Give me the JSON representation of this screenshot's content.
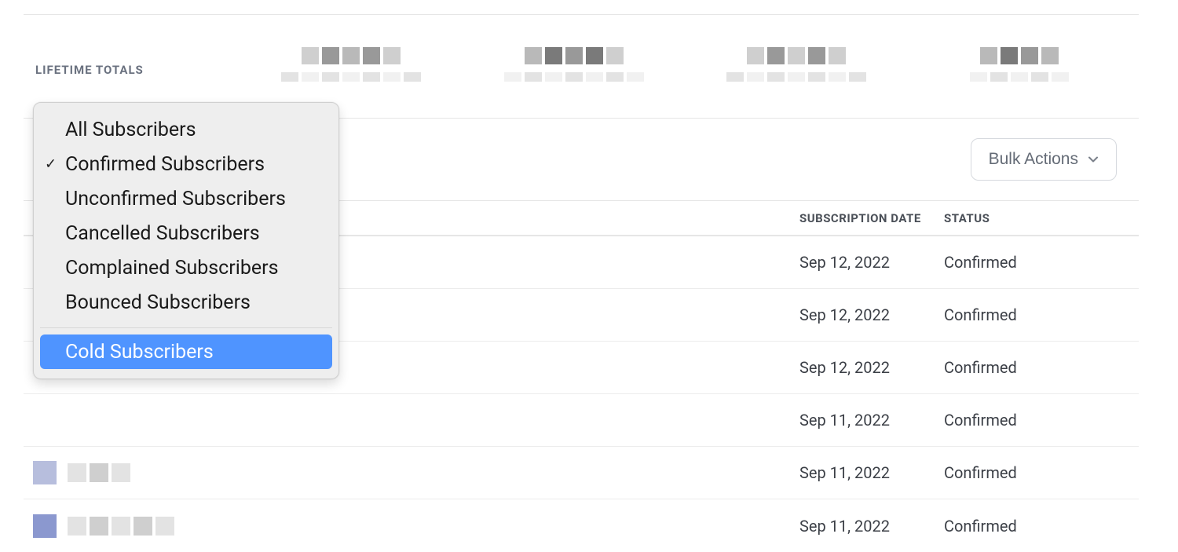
{
  "header": {
    "lifetime_totals_label": "LIFETIME TOTALS"
  },
  "toolbar": {
    "bulk_actions_label": "Bulk Actions"
  },
  "filter_dropdown": {
    "items": [
      {
        "label": "All Subscribers",
        "checked": false,
        "hover": false
      },
      {
        "label": "Confirmed Subscribers",
        "checked": true,
        "hover": false
      },
      {
        "label": "Unconfirmed Subscribers",
        "checked": false,
        "hover": false
      },
      {
        "label": "Cancelled Subscribers",
        "checked": false,
        "hover": false
      },
      {
        "label": "Complained Subscribers",
        "checked": false,
        "hover": false
      },
      {
        "label": "Bounced Subscribers",
        "checked": false,
        "hover": false
      }
    ],
    "secondary": [
      {
        "label": "Cold Subscribers",
        "checked": false,
        "hover": true
      }
    ]
  },
  "table": {
    "columns": {
      "subscription_date": "SUBSCRIPTION DATE",
      "status": "STATUS"
    },
    "rows": [
      {
        "date": "Sep 12, 2022",
        "status": "Confirmed"
      },
      {
        "date": "Sep 12, 2022",
        "status": "Confirmed"
      },
      {
        "date": "Sep 12, 2022",
        "status": "Confirmed"
      },
      {
        "date": "Sep 11, 2022",
        "status": "Confirmed"
      },
      {
        "date": "Sep 11, 2022",
        "status": "Confirmed"
      },
      {
        "date": "Sep 11, 2022",
        "status": "Confirmed"
      }
    ]
  }
}
